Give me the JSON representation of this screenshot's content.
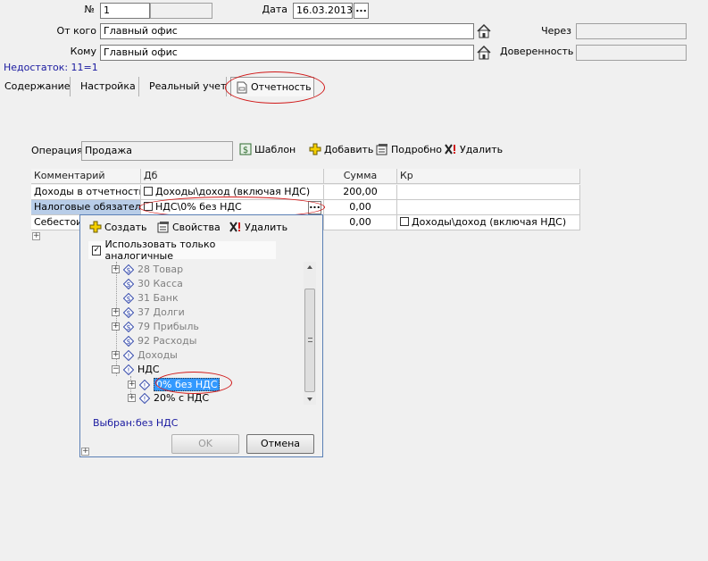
{
  "header": {
    "number_label": "№",
    "number_value": "1",
    "date_label": "Дата",
    "date_value": "16.03.2013",
    "date_button": "...",
    "from_label": "От кого",
    "from_value": "Главный офис",
    "to_label": "Кому",
    "to_value": "Главный офис",
    "via_label": "Через",
    "via_value": "",
    "proxy_label": "Доверенность",
    "proxy_value": "",
    "shortage": "Недостаток: 11=1"
  },
  "tabs": [
    {
      "label": "Содержание"
    },
    {
      "label": "Настройка"
    },
    {
      "label": "Реальный учет"
    },
    {
      "label": "Отчетность"
    }
  ],
  "operation": {
    "label": "Операция",
    "value": "Продажа",
    "template_button": "Шаблон",
    "add_button": "Добавить",
    "details_button": "Подробно",
    "delete_button": "Удалить"
  },
  "grid": {
    "headers": [
      "Комментарий",
      "Дб",
      "Сумма",
      "Кр"
    ],
    "rows": [
      {
        "comment": "Доходы в отчетность",
        "db": "Доходы\\доход (включая НДС)",
        "sum": "200,00",
        "kr": ""
      },
      {
        "comment": "Налоговые обязатель",
        "db": "НДС\\0% без НДС",
        "sum": "0,00",
        "kr": ""
      },
      {
        "comment": "Себестоим",
        "db": "",
        "sum": "0,00",
        "kr": "Доходы\\доход (включая НДС)"
      }
    ],
    "add_row": "+"
  },
  "popup": {
    "create_button": "Создать",
    "properties_button": "Свойства",
    "delete_button": "Удалить",
    "only_similar_label": "Использовать только аналогичные",
    "only_similar_checked": true,
    "tree": [
      {
        "label": "28 Товар",
        "expander": "+",
        "dim": true
      },
      {
        "label": "30 Касса",
        "expander": "",
        "dim": true
      },
      {
        "label": "31 Банк",
        "expander": "",
        "dim": true
      },
      {
        "label": "37 Долги",
        "expander": "+",
        "dim": true
      },
      {
        "label": "79 Прибыль",
        "expander": "+",
        "dim": true
      },
      {
        "label": "92 Расходы",
        "expander": "",
        "dim": true
      },
      {
        "label": "Доходы",
        "expander": "+",
        "dim": true
      },
      {
        "label": "НДС",
        "expander": "−",
        "dim": false
      },
      {
        "label": "0% без НДС",
        "expander": "+",
        "dim": false,
        "selected": true
      },
      {
        "label": "20% с НДС",
        "expander": "+",
        "dim": false
      }
    ],
    "selected_label": "Выбран:",
    "selected_value": "без НДС",
    "ok_button": "OK",
    "cancel_button": "Отмена"
  },
  "colors": {
    "accent": "#3399ff",
    "annotation": "#d01818",
    "shortage_text": "#1a1aa0",
    "tree_icon": "#3a4fae"
  }
}
